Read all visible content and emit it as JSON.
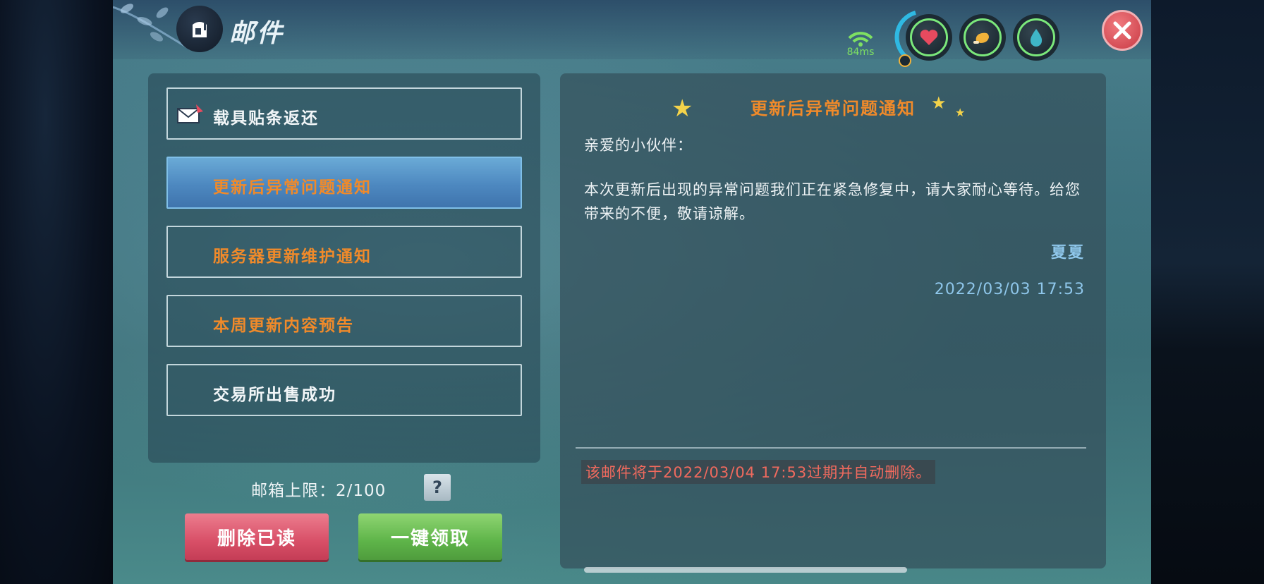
{
  "header": {
    "title": "邮件",
    "ping": "84ms",
    "stats": [
      {
        "name": "health",
        "icon": "heart-icon",
        "color": "#e84a5f"
      },
      {
        "name": "food",
        "icon": "drumstick-icon",
        "color": "#f1b23a"
      },
      {
        "name": "water",
        "icon": "water-drop-icon",
        "color": "#3fb6c8"
      }
    ],
    "close_icon": "close-icon"
  },
  "mail_list": {
    "items": [
      {
        "label": "载具贴条返还",
        "icon": "envelope-icon",
        "selected": false,
        "color": "white"
      },
      {
        "label": "更新后异常问题通知",
        "selected": true,
        "color": "orange"
      },
      {
        "label": "服务器更新维护通知",
        "selected": false,
        "color": "orange"
      },
      {
        "label": "本周更新内容预告",
        "selected": false,
        "color": "orange"
      },
      {
        "label": "交易所出售成功",
        "selected": false,
        "color": "white"
      }
    ]
  },
  "mailbox": {
    "limit_label": "邮箱上限：2/100",
    "help_label": "?"
  },
  "buttons": {
    "delete_read": "删除已读",
    "claim_all": "一键领取"
  },
  "mail_detail": {
    "title": "更新后异常问题通知",
    "greeting": "亲爱的小伙伴：",
    "body": "本次更新后出现的异常问题我们正在紧急修复中，请大家耐心等待。给您带来的不便，敬请谅解。",
    "sender": "夏夏",
    "date": "2022/03/03 17:53",
    "expire_notice": "该邮件将于2022/03/04 17:53过期并自动删除。"
  },
  "colors": {
    "accent_orange": "#f08a2a",
    "link_blue": "#8ec6ea",
    "warning_red": "#f06a5e",
    "selected_blue": "#4d88c0"
  }
}
